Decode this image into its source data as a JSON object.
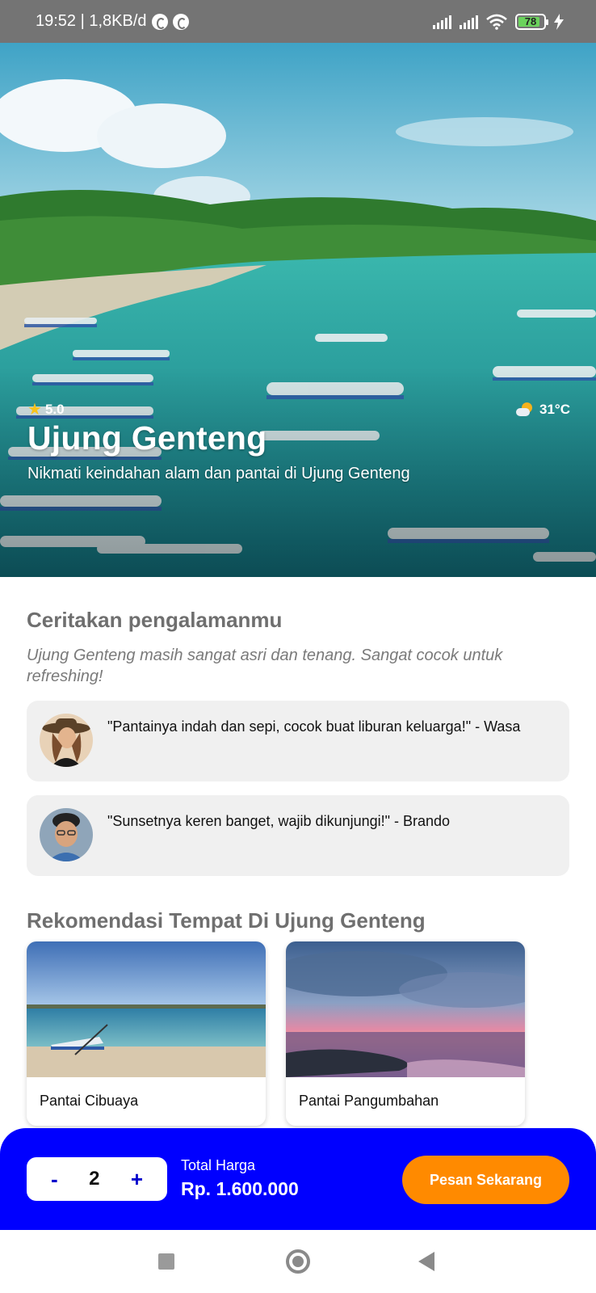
{
  "status_bar": {
    "time_info": "19:52 | 1,8KB/d",
    "battery": "78"
  },
  "hero": {
    "rating": "5.0",
    "temperature": "31°C",
    "title": "Ujung Genteng",
    "subtitle": "Nikmati keindahan alam dan pantai di Ujung Genteng"
  },
  "experience": {
    "heading": "Ceritakan pengalamanmu",
    "text": "Ujung Genteng masih sangat asri dan tenang. Sangat cocok untuk refreshing!",
    "reviews": [
      {
        "quote": "\"Pantainya indah dan sepi, cocok buat liburan keluarga!\" - Wasa"
      },
      {
        "quote": "\"Sunsetnya keren banget, wajib dikunjungi!\" - Brando"
      }
    ]
  },
  "recommendations": {
    "heading": "Rekomendasi Tempat Di Ujung Genteng",
    "places": [
      {
        "name": "Pantai Cibuaya"
      },
      {
        "name": "Pantai Pangumbahan"
      }
    ]
  },
  "booking": {
    "minus": "-",
    "quantity": "2",
    "plus": "+",
    "total_label": "Total Harga",
    "total_value": "Rp. 1.600.000",
    "order_button": "Pesan Sekarang"
  },
  "colors": {
    "booking_bar": "#0000ff",
    "order_button": "#ff8a00",
    "heading_gray": "#6f6f6f"
  }
}
